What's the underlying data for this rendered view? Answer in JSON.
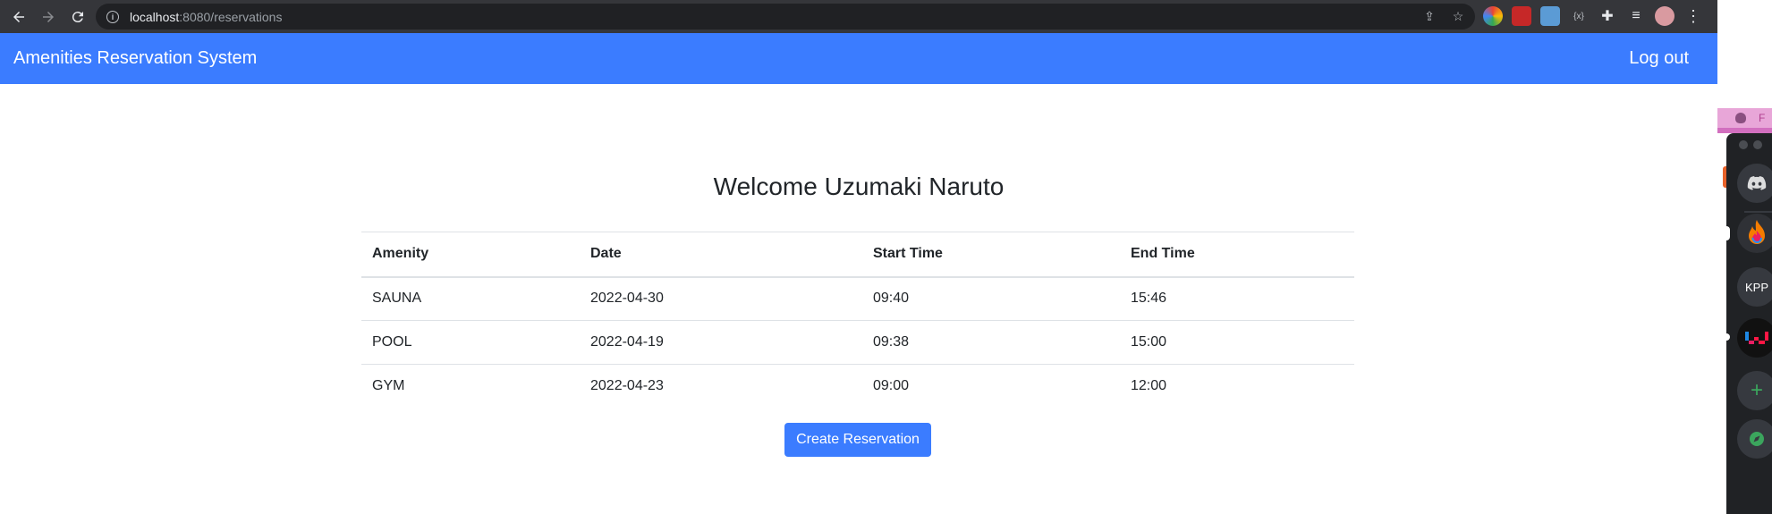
{
  "browser": {
    "url_host": "localhost",
    "url_rest": ":8080/reservations"
  },
  "navbar": {
    "brand": "Amenities Reservation System",
    "logout_label": "Log out"
  },
  "main": {
    "welcome": "Welcome Uzumaki Naruto",
    "table": {
      "headers": [
        "Amenity",
        "Date",
        "Start Time",
        "End Time"
      ],
      "rows": [
        [
          "SAUNA",
          "2022-04-30",
          "09:40",
          "15:46"
        ],
        [
          "POOL",
          "2022-04-19",
          "09:38",
          "15:00"
        ],
        [
          "GYM",
          "2022-04-23",
          "09:00",
          "12:00"
        ]
      ]
    },
    "create_label": "Create Reservation"
  },
  "sidebar_app": {
    "strip_text": "F",
    "server_kpp": "KPP",
    "add_symbol": "+"
  },
  "colors": {
    "primary": "#3b7cff",
    "browser_chrome": "#35363a",
    "text": "#212529"
  }
}
